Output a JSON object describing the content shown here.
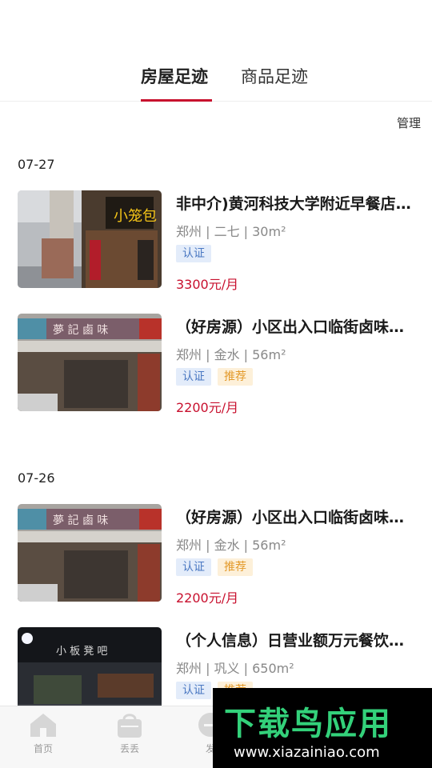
{
  "tabs": {
    "active": "房屋足迹",
    "inactive": "商品足迹"
  },
  "manage_label": "管理",
  "groups": [
    {
      "date": "07-27",
      "items": [
        {
          "title": "非中介)黄河科技大学附近早餐店转让",
          "meta": "郑州 | 二七 | 30m²",
          "tags": [
            "认证"
          ],
          "price": "3300元/月",
          "image": "storefront-xiao-chong-bao"
        },
        {
          "title": "（好房源）小区出入口临街卤味店转让",
          "meta": "郑州 | 金水 | 56m²",
          "tags": [
            "认证",
            "推荐"
          ],
          "price": "2200元/月",
          "image": "storefront-lu-wei"
        }
      ]
    },
    {
      "date": "07-26",
      "items": [
        {
          "title": "（好房源）小区出入口临街卤味店转让",
          "meta": "郑州 | 金水 | 56m²",
          "tags": [
            "认证",
            "推荐"
          ],
          "price": "2200元/月",
          "image": "storefront-lu-wei"
        },
        {
          "title": "（个人信息）日营业额万元餐饮店转让",
          "meta": "郑州 | 巩义 | 650m²",
          "tags": [
            "认证",
            "推荐"
          ],
          "price": "",
          "image": "storefront-night"
        }
      ]
    }
  ],
  "bottom_nav": [
    {
      "label": "首页",
      "icon": "home-icon"
    },
    {
      "label": "丢丢",
      "icon": "bag-icon"
    },
    {
      "label": "发",
      "icon": "publish-icon"
    }
  ],
  "watermark": {
    "title": "下载鸟应用",
    "url": "www.xiazainiao.com"
  },
  "colors": {
    "accent": "#c8102e",
    "tag_verified_bg": "#e3ecfa",
    "tag_recommend_bg": "#fdf0d9"
  }
}
